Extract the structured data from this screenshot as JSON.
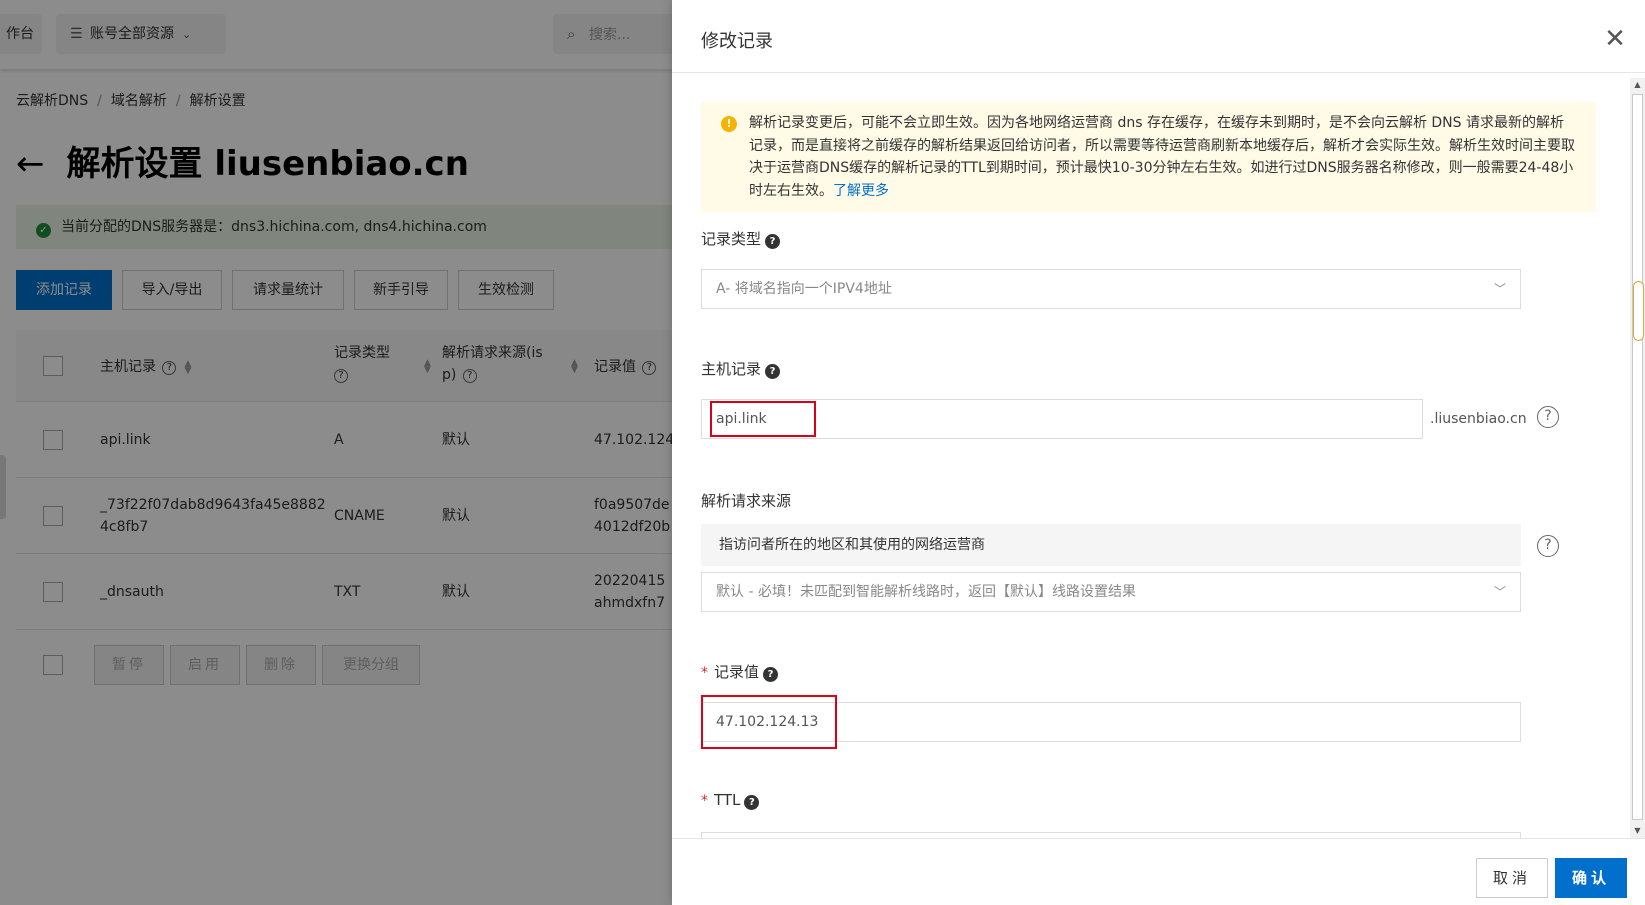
{
  "topbar": {
    "console_label": "作台",
    "resources_label": "账号全部资源",
    "search_placeholder": "搜索..."
  },
  "breadcrumb": {
    "items": [
      "云解析DNS",
      "域名解析",
      "解析设置"
    ],
    "separator": "/"
  },
  "page": {
    "title": "解析设置 liusenbiao.cn",
    "back_glyph": "←",
    "dns_notice": "当前分配的DNS服务器是：dns3.hichina.com, dns4.hichina.com"
  },
  "toolbar": {
    "buttons": [
      "添加记录",
      "导入/导出",
      "请求量统计",
      "新手引导",
      "生效检测"
    ]
  },
  "table": {
    "headers": {
      "host": "主机记录",
      "type_line1": "记录类型",
      "source_line1": "解析请求来源(is",
      "source_line2": "p)",
      "value": "记录值"
    },
    "rows": [
      {
        "host": "api.link",
        "host2": "",
        "type": "A",
        "source": "默认",
        "value": "47.102.124",
        "value2": ""
      },
      {
        "host": "_73f22f07dab8d9643fa45e8882",
        "host2": "4c8fb7",
        "type": "CNAME",
        "source": "默认",
        "value": "f0a9507de",
        "value2": "4012df20b"
      },
      {
        "host": "_dnsauth",
        "host2": "",
        "type": "TXT",
        "source": "默认",
        "value": "20220415",
        "value2": "ahmdxfn7"
      }
    ]
  },
  "batch": {
    "buttons": [
      "暂停",
      "启用",
      "删除",
      "更换分组"
    ]
  },
  "drawer": {
    "title": "修改记录",
    "close_glyph": "✕",
    "notice": "解析记录变更后，可能不会立即生效。因为各地网络运营商 dns 存在缓存，在缓存未到期时，是不会向云解析 DNS 请求最新的解析记录，而是直接将之前缓存的解析结果返回给访问者，所以需要等待运营商刷新本地缓存后，解析才会实际生效。解析生效时间主要取决于运营商DNS缓存的解析记录的TTL到期时间，预计最快10-30分钟左右生效。如进行过DNS服务器名称修改，则一般需要24-48小时左右生效。",
    "notice_link": "了解更多",
    "record_type_label": "记录类型",
    "record_type_value": "A- 将域名指向一个IPV4地址",
    "host_label": "主机记录",
    "host_value": "api.link",
    "host_suffix": ".liusenbiao.cn",
    "source_label": "解析请求来源",
    "source_desc": "指访问者所在的地区和其使用的网络运营商",
    "source_value": "默认 - 必填！未匹配到智能解析线路时，返回【默认】线路设置结果",
    "value_label": "记录值",
    "value_value": "47.102.124.13",
    "ttl_label": "TTL",
    "required_mark": "*",
    "cancel_label": "取消",
    "ok_label": "确认"
  },
  "colors": {
    "primary": "#0070cc",
    "highlight_box": "#d9001b",
    "warning_bg": "#fffbe6",
    "success_bg": "#eaf5e5"
  }
}
